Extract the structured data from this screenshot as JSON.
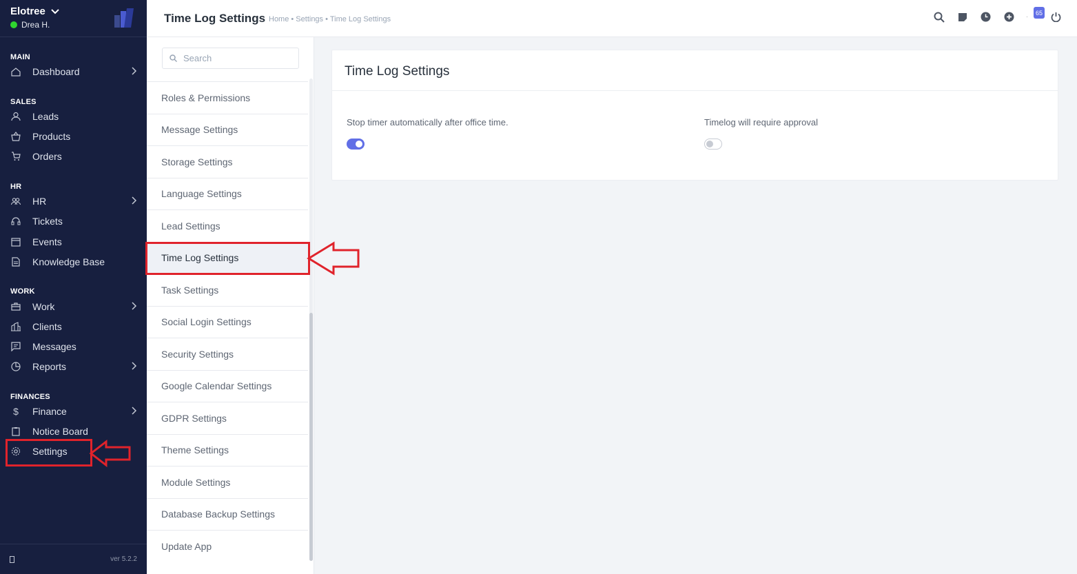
{
  "sidebar": {
    "company": "Elotree",
    "user": "Drea H.",
    "sections": {
      "main": "MAIN",
      "sales": "SALES",
      "hr": "HR",
      "work": "WORK",
      "finances": "FINANCES"
    },
    "items": {
      "dashboard": "Dashboard",
      "leads": "Leads",
      "products": "Products",
      "orders": "Orders",
      "hr": "HR",
      "tickets": "Tickets",
      "events": "Events",
      "knowledge_base": "Knowledge Base",
      "work": "Work",
      "clients": "Clients",
      "messages": "Messages",
      "reports": "Reports",
      "finance": "Finance",
      "notice_board": "Notice Board",
      "settings": "Settings"
    },
    "version": "ver 5.2.2"
  },
  "header": {
    "title": "Time Log Settings",
    "breadcrumb": "Home • Settings • Time Log Settings",
    "notification_count": "65"
  },
  "submenu": {
    "search_placeholder": "Search",
    "items": [
      "Roles & Permissions",
      "Message Settings",
      "Storage Settings",
      "Language Settings",
      "Lead Settings",
      "Time Log Settings",
      "Task Settings",
      "Social Login Settings",
      "Security Settings",
      "Google Calendar Settings",
      "GDPR Settings",
      "Theme Settings",
      "Module Settings",
      "Database Backup Settings",
      "Update App"
    ],
    "active": "Time Log Settings"
  },
  "card": {
    "title": "Time Log Settings",
    "setting_1": {
      "label": "Stop timer automatically after office time.",
      "enabled": true
    },
    "setting_2": {
      "label": "Timelog will require approval",
      "enabled": false
    }
  },
  "colors": {
    "sidebar_bg": "#171f3f",
    "accent": "#616fe6",
    "annotation": "#e0232b",
    "online": "#2fd62f"
  }
}
